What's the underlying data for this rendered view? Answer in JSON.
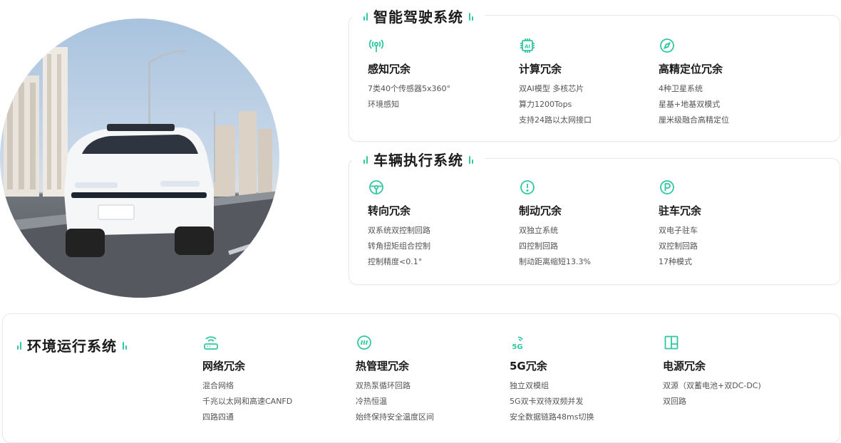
{
  "sections": {
    "smart_driving": {
      "title": "智能驾驶系统",
      "items": [
        {
          "icon": "sensor-signal-icon",
          "title": "感知冗余",
          "lines": [
            "7类40个传感器5x360°",
            "环境感知"
          ]
        },
        {
          "icon": "ai-chip-icon",
          "title": "计算冗余",
          "lines": [
            "双AI模型 多核芯片",
            "算力1200Tops",
            "支持24路以太网接口"
          ]
        },
        {
          "icon": "compass-icon",
          "title": "高精定位冗余",
          "lines": [
            "4种卫星系统",
            "星基+地基双模式",
            "厘米级融合高精定位"
          ]
        }
      ]
    },
    "vehicle_exec": {
      "title": "车辆执行系统",
      "items": [
        {
          "icon": "steering-wheel-icon",
          "title": "转向冗余",
          "lines": [
            "双系统双控制回路",
            "转角扭矩组合控制",
            "控制精度<0.1°"
          ]
        },
        {
          "icon": "brake-warning-icon",
          "title": "制动冗余",
          "lines": [
            "双独立系统",
            "四控制回路",
            "制动距离缩短13.3%"
          ]
        },
        {
          "icon": "parking-icon",
          "title": "驻车冗余",
          "lines": [
            "双电子驻车",
            "双控制回路",
            "17种模式"
          ]
        }
      ]
    },
    "environment": {
      "title": "环境运行系统",
      "items": [
        {
          "icon": "router-icon",
          "title": "网络冗余",
          "lines": [
            "混合网络",
            "千兆以太网和高速CANFD",
            "四路四通"
          ]
        },
        {
          "icon": "thermal-icon",
          "title": "热管理冗余",
          "lines": [
            "双热泵循环回路",
            "冷热恒温",
            "始终保持安全温度区间"
          ]
        },
        {
          "icon": "5g-icon",
          "icon_text": "5G",
          "title": "5G冗余",
          "lines": [
            "独立双模组",
            "5G双卡双待双频并发",
            "安全数据链路48ms切换"
          ]
        },
        {
          "icon": "power-panel-icon",
          "title": "电源冗余",
          "lines": [
            "双源（双蓄电池+双DC-DC)",
            "双回路"
          ]
        }
      ]
    }
  },
  "colors": {
    "accent": "#31c7a2",
    "border": "#e6e9ec",
    "text": "#1b1b1b",
    "muted": "#555555"
  }
}
